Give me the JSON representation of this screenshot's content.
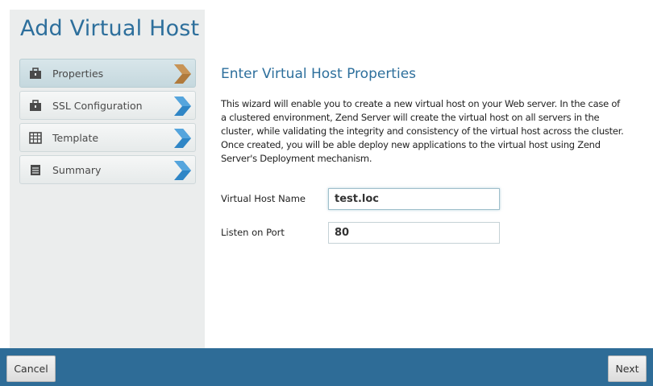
{
  "wizard": {
    "title": "Add Virtual Host"
  },
  "steps": [
    {
      "label": "Properties",
      "icon": "briefcase-icon",
      "active": true
    },
    {
      "label": "SSL Configuration",
      "icon": "briefcase-icon",
      "active": false
    },
    {
      "label": "Template",
      "icon": "grid-icon",
      "active": false
    },
    {
      "label": "Summary",
      "icon": "list-icon",
      "active": false
    }
  ],
  "content": {
    "heading": "Enter Virtual Host Properties",
    "description": "This wizard will enable you to create a new virtual host on your Web server. In the case of a clustered environment, Zend Server will create the virtual host on all servers in the cluster, while validating the integrity and consistency of the virtual host across the cluster. Once created, you will be able deploy new applications to the virtual host using Zend Server's Deployment mechanism."
  },
  "form": {
    "host_name_label": "Virtual Host Name",
    "host_name_value": "test.loc",
    "port_label": "Listen on Port",
    "port_value": "80"
  },
  "footer": {
    "cancel_label": "Cancel",
    "next_label": "Next"
  },
  "colors": {
    "accent": "#2d6f9c",
    "footer": "#2e6c97",
    "active_arrow": "#b07a3c",
    "inactive_arrow": "#3b8fcb"
  }
}
